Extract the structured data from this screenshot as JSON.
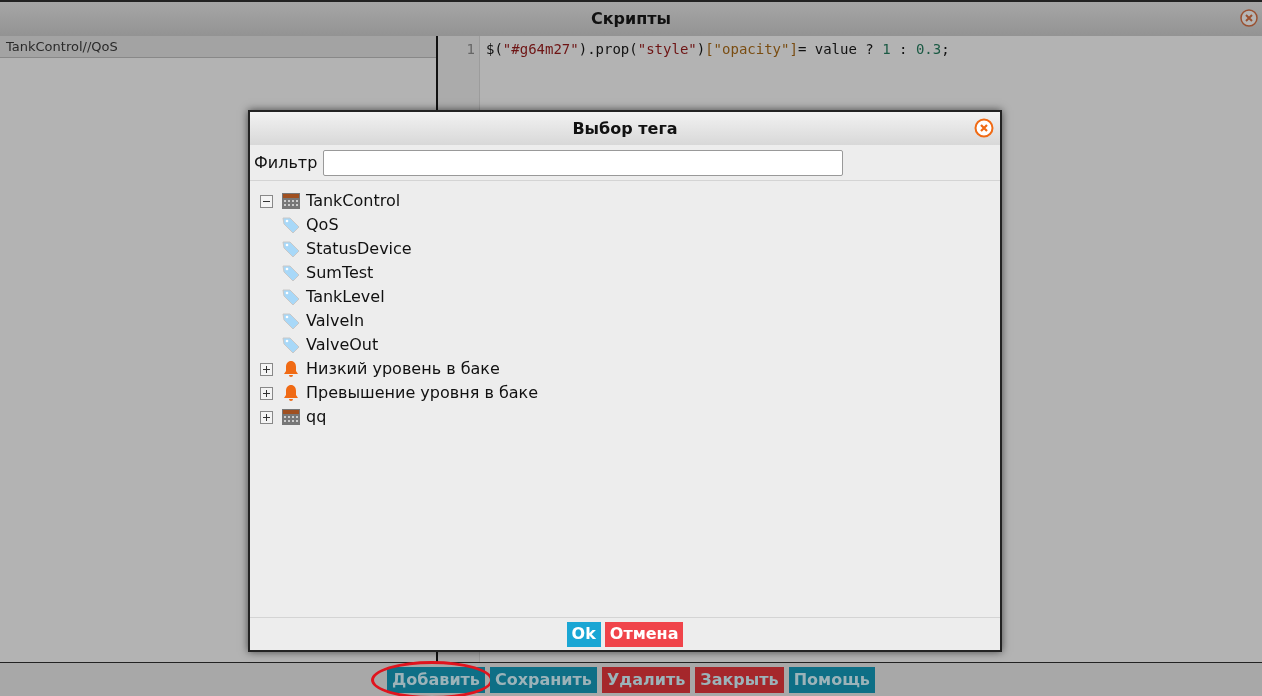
{
  "window": {
    "title": "Скрипты"
  },
  "sidebar": {
    "items": [
      {
        "label": "TankControl//QoS",
        "selected": true
      }
    ]
  },
  "editor": {
    "lines": [
      {
        "number": "1",
        "tokens": [
          {
            "kind": "plain",
            "text": "$("
          },
          {
            "kind": "string",
            "text": "\"#g64m27\""
          },
          {
            "kind": "plain",
            "text": ").prop("
          },
          {
            "kind": "string",
            "text": "\"style\""
          },
          {
            "kind": "plain",
            "text": ")"
          },
          {
            "kind": "key",
            "text": "[\"opacity\"]"
          },
          {
            "kind": "plain",
            "text": "= value ? "
          },
          {
            "kind": "number",
            "text": "1"
          },
          {
            "kind": "plain",
            "text": " : "
          },
          {
            "kind": "number",
            "text": "0.3"
          },
          {
            "kind": "plain",
            "text": ";"
          }
        ]
      }
    ]
  },
  "toolbar": [
    {
      "label": "Добавить",
      "kind": "primary",
      "highlighted": true
    },
    {
      "label": "Сохранить",
      "kind": "primary",
      "highlighted": false
    },
    {
      "label": "Удалить",
      "kind": "danger",
      "highlighted": false
    },
    {
      "label": "Закрыть",
      "kind": "danger",
      "highlighted": false
    },
    {
      "label": "Помощь",
      "kind": "primary",
      "highlighted": false
    }
  ],
  "dialog": {
    "title": "Выбор тега",
    "filter": {
      "label": "Фильтр"
    },
    "tree": [
      {
        "label": "TankControl",
        "kind": "device",
        "expanded": true,
        "children": [
          {
            "label": "QoS",
            "kind": "tag"
          },
          {
            "label": "StatusDevice",
            "kind": "tag"
          },
          {
            "label": "SumTest",
            "kind": "tag"
          },
          {
            "label": "TankLevel",
            "kind": "tag"
          },
          {
            "label": "ValveIn",
            "kind": "tag"
          },
          {
            "label": "ValveOut",
            "kind": "tag"
          }
        ]
      },
      {
        "label": "Низкий уровень в баке",
        "kind": "alarm",
        "expanded": false
      },
      {
        "label": "Превышение уровня в баке",
        "kind": "alarm",
        "expanded": false
      },
      {
        "label": "qq",
        "kind": "device",
        "expanded": false
      }
    ],
    "buttons": [
      {
        "label": "Ok",
        "kind": "primary"
      },
      {
        "label": "Отмена",
        "kind": "danger"
      }
    ]
  }
}
